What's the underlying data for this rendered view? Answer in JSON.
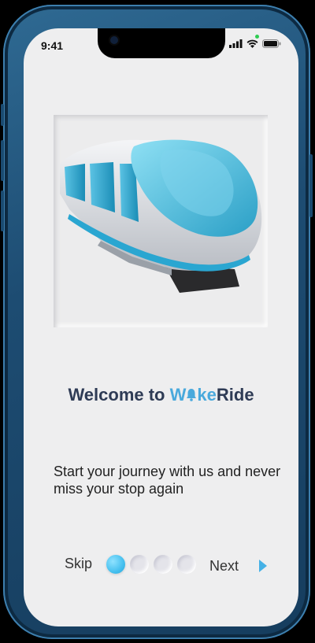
{
  "status_bar": {
    "time": "9:41",
    "icons": [
      "signal-icon",
      "wifi-icon",
      "battery-icon"
    ]
  },
  "onboarding": {
    "title_prefix": "Welcome to",
    "brand_part1": "W",
    "brand_part2": "ke",
    "brand_part3": "Ride",
    "subtitle": "Start your journey with us and never miss your stop again",
    "skip_label": "Skip",
    "next_label": "Next",
    "page_total": 4,
    "page_current": 1
  },
  "colors": {
    "brand_blue": "#49a9dc",
    "title_dark": "#2e3b55",
    "phone_frame": "#1d4c72",
    "screen_bg": "#eeeeef"
  }
}
